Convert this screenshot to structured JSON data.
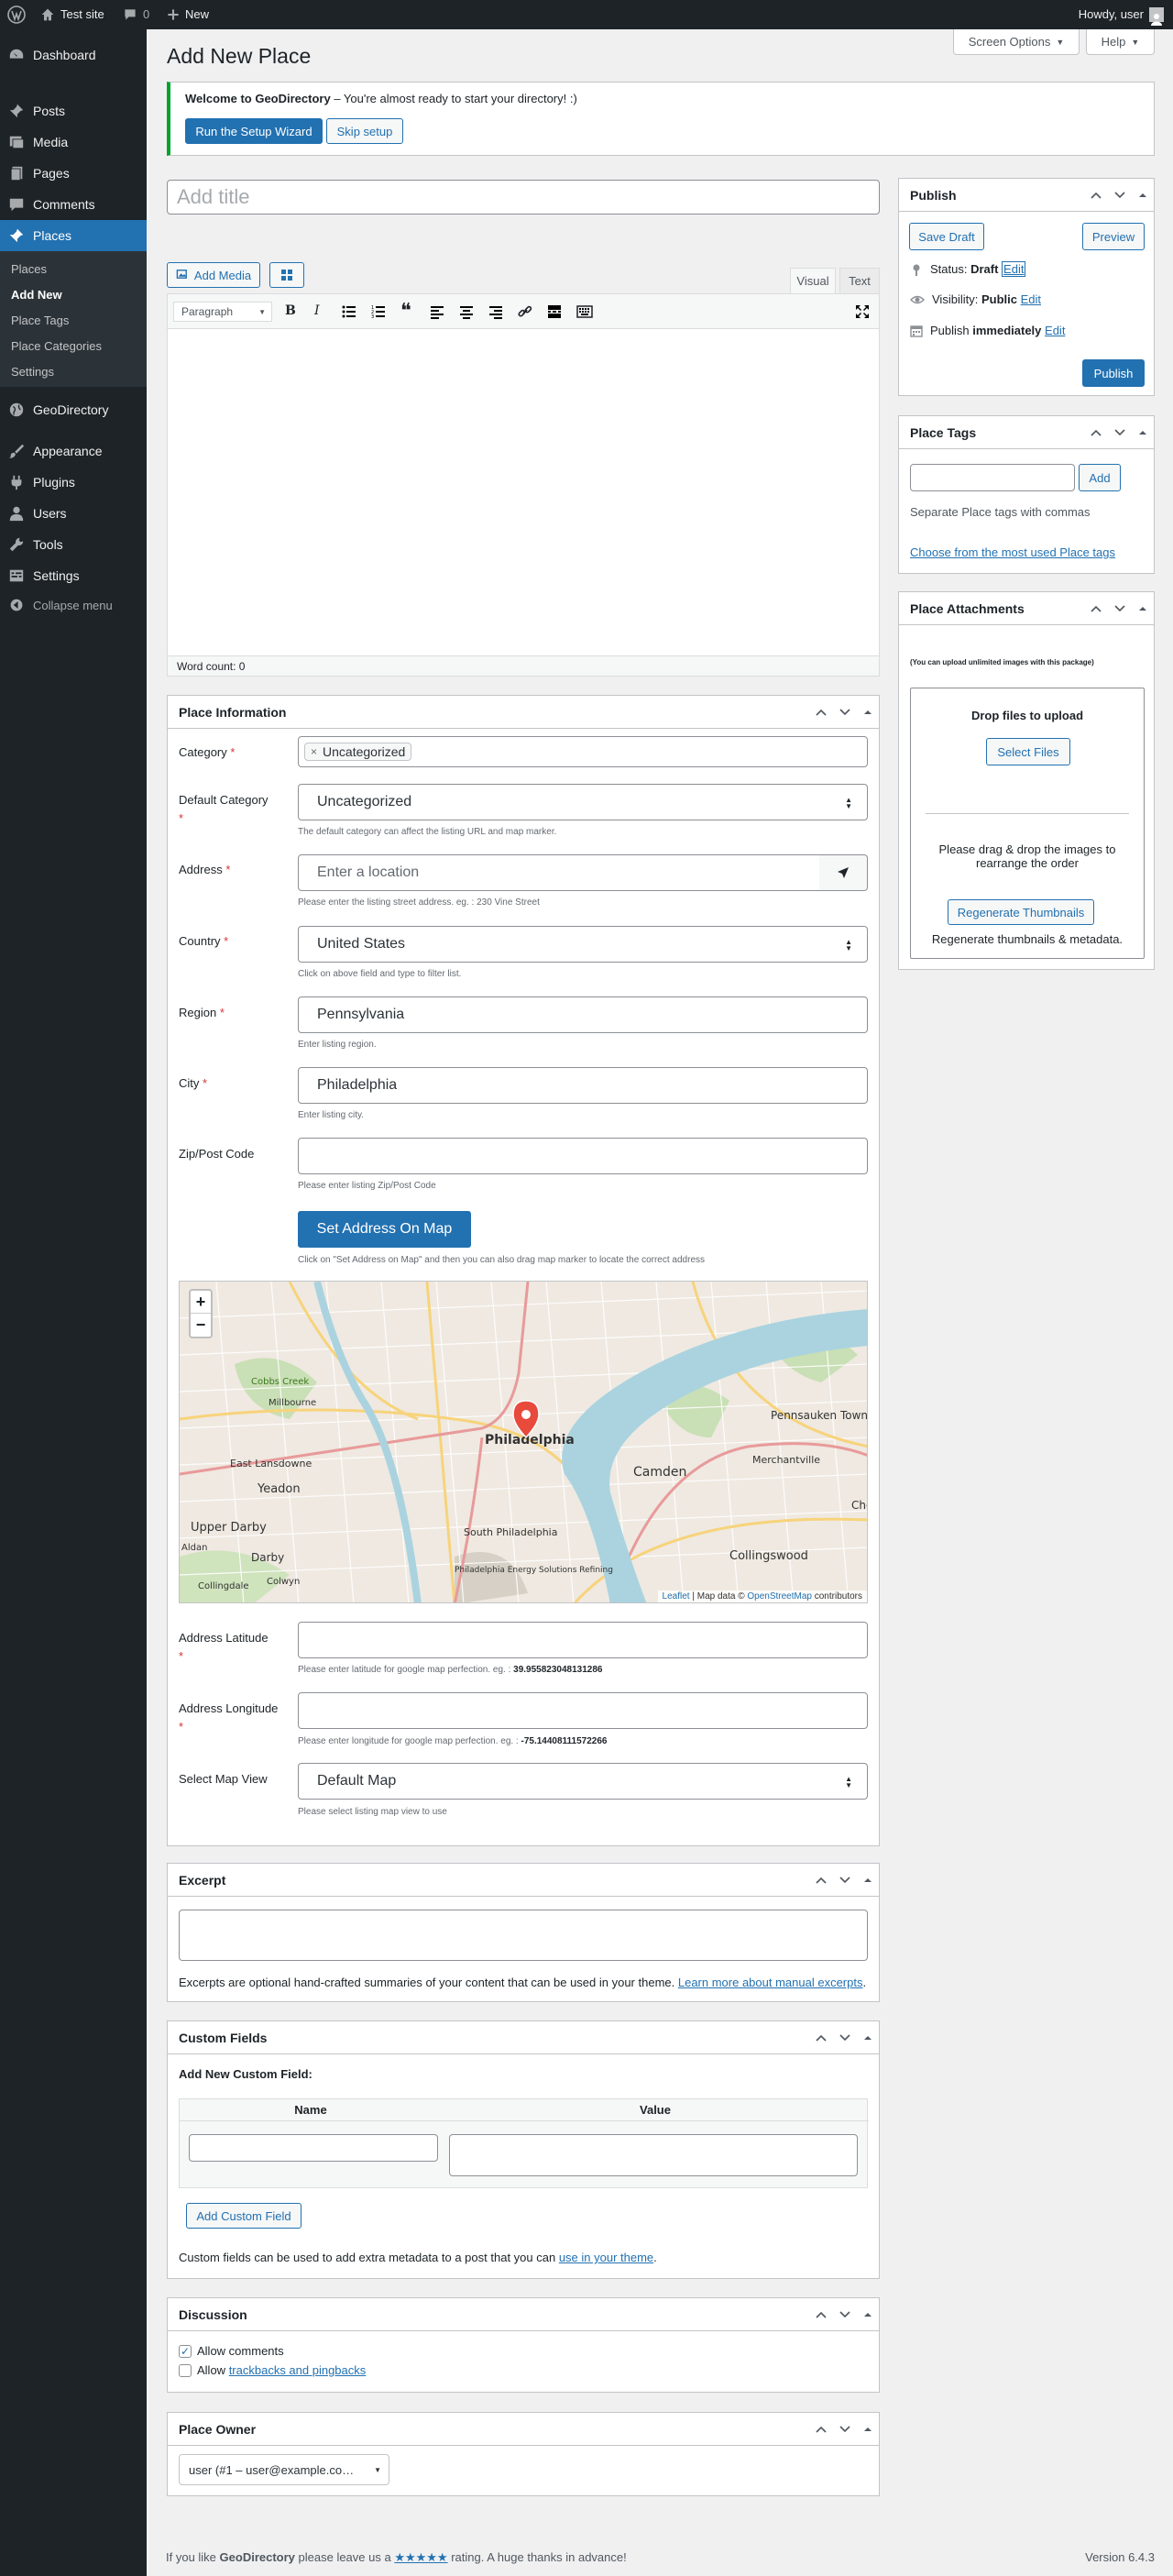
{
  "adminbar": {
    "site_name": "Test site",
    "comments_count": "0",
    "new_label": "New",
    "howdy": "Howdy, user"
  },
  "sidebar": {
    "items": [
      {
        "label": "Dashboard",
        "icon": "dashboard-icon"
      },
      {
        "label": "Posts",
        "icon": "pin-icon"
      },
      {
        "label": "Media",
        "icon": "media-icon"
      },
      {
        "label": "Pages",
        "icon": "pages-icon"
      },
      {
        "label": "Comments",
        "icon": "comments-icon"
      },
      {
        "label": "Places",
        "icon": "pin-icon"
      },
      {
        "label": "GeoDirectory",
        "icon": "globe-icon"
      },
      {
        "label": "Appearance",
        "icon": "brush-icon"
      },
      {
        "label": "Plugins",
        "icon": "plug-icon"
      },
      {
        "label": "Users",
        "icon": "users-icon"
      },
      {
        "label": "Tools",
        "icon": "wrench-icon"
      },
      {
        "label": "Settings",
        "icon": "settings-icon"
      }
    ],
    "submenu": [
      "Places",
      "Add New",
      "Place Tags",
      "Place Categories",
      "Settings"
    ],
    "collapse": "Collapse menu"
  },
  "header": {
    "screen_options": "Screen Options",
    "help": "Help",
    "title": "Add New Place"
  },
  "notice": {
    "strong": "Welcome to GeoDirectory",
    "text": " – You're almost ready to start your directory! :)",
    "wizard_button": "Run the Setup Wizard",
    "skip_button": "Skip setup"
  },
  "title_placeholder": "Add title",
  "editor": {
    "add_media": "Add Media",
    "tab_visual": "Visual",
    "tab_text": "Text",
    "format": "Paragraph",
    "word_count": "Word count: 0"
  },
  "place_info": {
    "title": "Place Information",
    "category_label": "Category",
    "category_tag": "Uncategorized",
    "default_category_label": "Default Category",
    "default_category_value": "Uncategorized",
    "default_category_help": "The default category can affect the listing URL and map marker.",
    "address_label": "Address",
    "address_placeholder": "Enter a location",
    "address_help": "Please enter the listing street address. eg. : 230 Vine Street",
    "country_label": "Country",
    "country_value": "United States",
    "country_help": "Click on above field and type to filter list.",
    "region_label": "Region",
    "region_value": "Pennsylvania",
    "region_help": "Enter listing region.",
    "city_label": "City",
    "city_value": "Philadelphia",
    "city_help": "Enter listing city.",
    "zip_label": "Zip/Post Code",
    "zip_help": "Please enter listing Zip/Post Code",
    "set_address_button": "Set Address On Map",
    "set_address_help": "Click on \"Set Address on Map\" and then you can also drag map marker to locate the correct address",
    "map_attribution_leaflet": "Leaflet",
    "map_attribution_mid": " | Map data © ",
    "map_attribution_osm": "OpenStreetMap",
    "map_attribution_end": " contributors",
    "map_labels": [
      "Philadelphia",
      "Camden",
      "Pennsauken Township",
      "Merchantville",
      "Collingswood",
      "South Philadelphia",
      "Upper Darby",
      "Yeadon",
      "East Lansdowne",
      "Darby",
      "Millbourne",
      "Cobbs Creek",
      "Aldan",
      "Colwyn",
      "Collingdale",
      "Philadelphia Energy Solutions Refining",
      "Che"
    ],
    "lat_label": "Address Latitude",
    "lat_help_prefix": "Please enter latitude for google map perfection. eg. : ",
    "lat_help_value": "39.955823048131286",
    "lng_label": "Address Longitude",
    "lng_help_prefix": "Please enter longitude for google map perfection. eg. : ",
    "lng_help_value": "-75.14408111572266",
    "mapview_label": "Select Map View",
    "mapview_value": "Default Map",
    "mapview_help": "Please select listing map view to use"
  },
  "excerpt": {
    "title": "Excerpt",
    "help": "Excerpts are optional hand-crafted summaries of your content that can be used in your theme. ",
    "link": "Learn more about manual excerpts",
    "help_end": "."
  },
  "custom_fields": {
    "title": "Custom Fields",
    "add_new": "Add New Custom Field:",
    "col_name": "Name",
    "col_value": "Value",
    "add_button": "Add Custom Field",
    "help": "Custom fields can be used to add extra metadata to a post that you can ",
    "link": "use in your theme",
    "help_end": "."
  },
  "discussion": {
    "title": "Discussion",
    "allow_comments": "Allow comments",
    "allow_trackbacks_prefix": "Allow ",
    "allow_trackbacks_link": "trackbacks and pingbacks"
  },
  "owner": {
    "title": "Place Owner",
    "value": "user (#1 – user@example.co…"
  },
  "publish": {
    "title": "Publish",
    "save_draft": "Save Draft",
    "preview": "Preview",
    "status_label": "Status: ",
    "status_value": "Draft",
    "visibility_label": "Visibility: ",
    "visibility_value": "Public",
    "publish_label": "Publish ",
    "publish_value": "immediately",
    "edit": "Edit",
    "publish_button": "Publish"
  },
  "tags": {
    "title": "Place Tags",
    "add": "Add",
    "help": "Separate Place tags with commas",
    "choose": "Choose from the most used Place tags"
  },
  "attachments": {
    "title": "Place Attachments",
    "note": "(You can upload unlimited images with this package)",
    "drop": "Drop files to upload",
    "select": "Select Files",
    "drag_help": "Please drag & drop the images to rearrange the order",
    "regenerate": "Regenerate Thumbnails",
    "regenerate_help": "Regenerate thumbnails & metadata."
  },
  "footer": {
    "prefix": "If you like ",
    "brand": "GeoDirectory",
    "middle": " please leave us a ",
    "stars": "★★★★★",
    "end": " rating. A huge thanks in advance!",
    "version": "Version 6.4.3"
  },
  "colors": {
    "primary": "#2271b1",
    "adminbar": "#1d2327",
    "notice_border": "#00a32a",
    "required": "#d63638"
  }
}
